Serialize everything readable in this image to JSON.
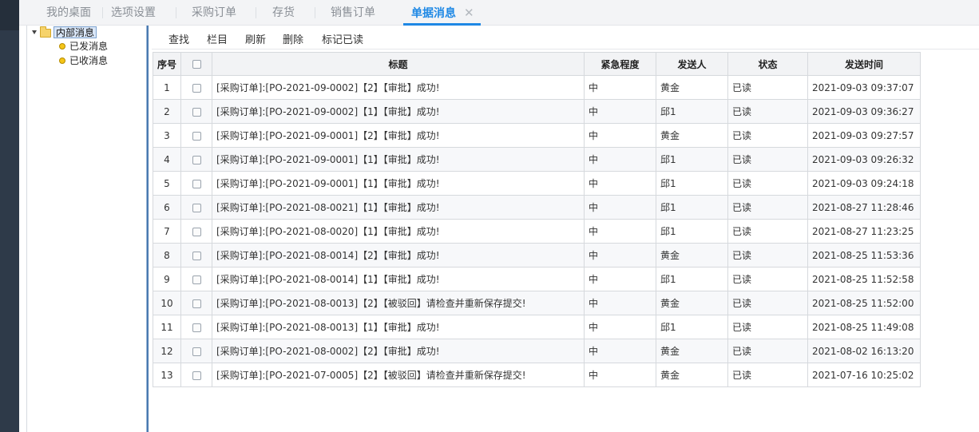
{
  "tabs": [
    {
      "label": "我的桌面",
      "active": false
    },
    {
      "label": "选项设置",
      "active": false
    },
    {
      "label": "采购订单",
      "active": false
    },
    {
      "label": "存货",
      "active": false
    },
    {
      "label": "销售订单",
      "active": false
    },
    {
      "label": "单据消息",
      "active": true
    }
  ],
  "close_glyph": "✕",
  "tree": {
    "root": "内部消息",
    "children": [
      "已发消息",
      "已收消息"
    ]
  },
  "toolbar": {
    "find": "查找",
    "columns": "栏目",
    "refresh": "刷新",
    "delete": "删除",
    "mark_read": "标记已读"
  },
  "grid": {
    "headers": [
      "序号",
      "",
      "标题",
      "紧急程度",
      "发送人",
      "状态",
      "发送时间"
    ],
    "rows": [
      [
        "1",
        "[采购订单]:[PO-2021-09-0002]【2】【审批】成功!",
        "中",
        "黄金",
        "已读",
        "2021-09-03 09:37:07"
      ],
      [
        "2",
        "[采购订单]:[PO-2021-09-0002]【1】【审批】成功!",
        "中",
        "邱1",
        "已读",
        "2021-09-03 09:36:27"
      ],
      [
        "3",
        "[采购订单]:[PO-2021-09-0001]【2】【审批】成功!",
        "中",
        "黄金",
        "已读",
        "2021-09-03 09:27:57"
      ],
      [
        "4",
        "[采购订单]:[PO-2021-09-0001]【1】【审批】成功!",
        "中",
        "邱1",
        "已读",
        "2021-09-03 09:26:32"
      ],
      [
        "5",
        "[采购订单]:[PO-2021-09-0001]【1】【审批】成功!",
        "中",
        "邱1",
        "已读",
        "2021-09-03 09:24:18"
      ],
      [
        "6",
        "[采购订单]:[PO-2021-08-0021]【1】【审批】成功!",
        "中",
        "邱1",
        "已读",
        "2021-08-27 11:28:46"
      ],
      [
        "7",
        "[采购订单]:[PO-2021-08-0020]【1】【审批】成功!",
        "中",
        "邱1",
        "已读",
        "2021-08-27 11:23:25"
      ],
      [
        "8",
        "[采购订单]:[PO-2021-08-0014]【2】【审批】成功!",
        "中",
        "黄金",
        "已读",
        "2021-08-25 11:53:36"
      ],
      [
        "9",
        "[采购订单]:[PO-2021-08-0014]【1】【审批】成功!",
        "中",
        "邱1",
        "已读",
        "2021-08-25 11:52:58"
      ],
      [
        "10",
        "[采购订单]:[PO-2021-08-0013]【2】【被驳回】请检查并重新保存提交!",
        "中",
        "黄金",
        "已读",
        "2021-08-25 11:52:00"
      ],
      [
        "11",
        "[采购订单]:[PO-2021-08-0013]【1】【审批】成功!",
        "中",
        "邱1",
        "已读",
        "2021-08-25 11:49:08"
      ],
      [
        "12",
        "[采购订单]:[PO-2021-08-0002]【2】【审批】成功!",
        "中",
        "黄金",
        "已读",
        "2021-08-02 16:13:20"
      ],
      [
        "13",
        "[采购订单]:[PO-2021-07-0005]【2】【被驳回】请检查并重新保存提交!",
        "中",
        "黄金",
        "已读",
        "2021-07-16 10:25:02"
      ]
    ]
  }
}
